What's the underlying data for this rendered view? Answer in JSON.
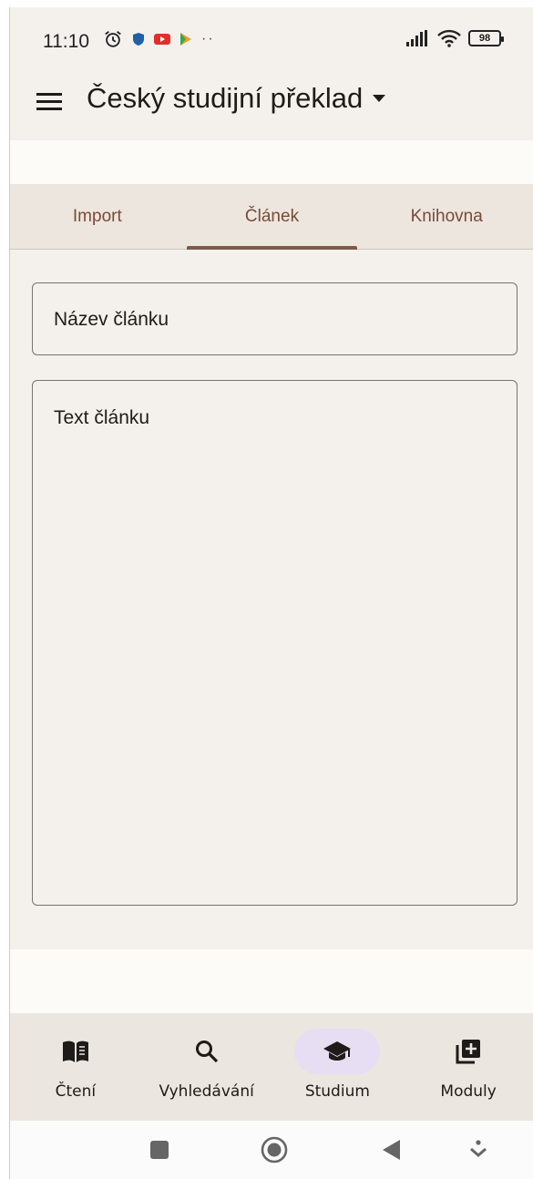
{
  "status_bar": {
    "time": "11:10",
    "battery": "98"
  },
  "app_bar": {
    "title": "Český studijní překlad"
  },
  "tabs": [
    {
      "label": "Import",
      "active": false
    },
    {
      "label": "Článek",
      "active": true
    },
    {
      "label": "Knihovna",
      "active": false
    }
  ],
  "form": {
    "title_placeholder": "Název článku",
    "text_placeholder": "Text článku"
  },
  "bottom_nav": [
    {
      "label": "Čtení",
      "icon": "book-icon",
      "active": false
    },
    {
      "label": "Vyhledávání",
      "icon": "search-icon",
      "active": false
    },
    {
      "label": "Studium",
      "icon": "graduation-cap-icon",
      "active": true
    },
    {
      "label": "Moduly",
      "icon": "add-module-icon",
      "active": false
    }
  ],
  "colors": {
    "background": "#f4f1ed",
    "accent": "#7a4a36",
    "active_nav": "#e8def3"
  }
}
